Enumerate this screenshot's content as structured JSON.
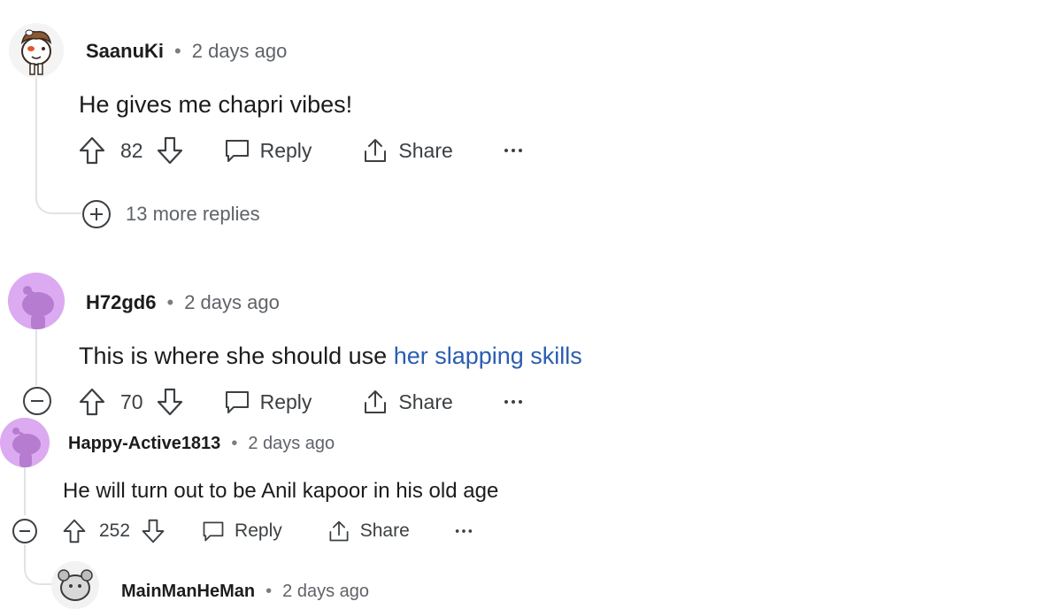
{
  "comments": [
    {
      "username": "SaanuKi",
      "time": "2 days ago",
      "body": "He gives me chapri vibes!",
      "score": "82",
      "reply_label": "Reply",
      "share_label": "Share",
      "more_replies": "13 more replies"
    },
    {
      "username": "H72gd6",
      "time": "2 days ago",
      "body_plain": "This is where she should use ",
      "body_link": "her slapping skills",
      "score": "70",
      "reply_label": "Reply",
      "share_label": "Share"
    },
    {
      "username": "Happy-Active1813",
      "time": "2 days ago",
      "body": "He will turn out to be Anil kapoor in his old age",
      "score": "252",
      "reply_label": "Reply",
      "share_label": "Share"
    },
    {
      "username": "MainManHeMan",
      "time": "2 days ago"
    }
  ],
  "colors": {
    "link": "#2a5db0",
    "avatar_purple": "#dcaaf0",
    "snoo_purple": "#b57cd0",
    "thread_line": "#dfe3e6"
  }
}
